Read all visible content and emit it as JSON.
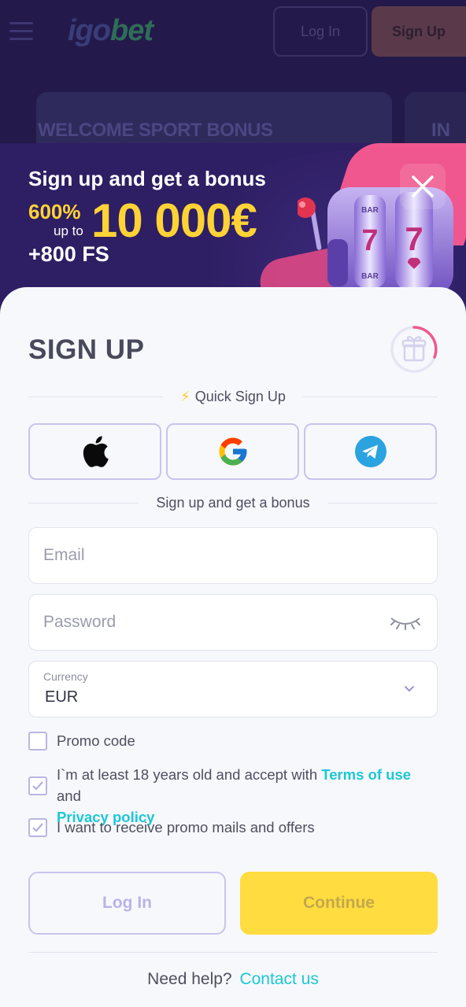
{
  "header": {
    "logo_text": "igobet",
    "login_label": "Log In",
    "signup_label": "Sign Up"
  },
  "background": {
    "banner_title": "WELCOME SPORT BONUS",
    "banner2_title": "IN"
  },
  "promo": {
    "headline": "Sign up and get a bonus",
    "percent": "600%",
    "up_to": "up to",
    "amount": "10 000€",
    "free_spins": "+800 FS"
  },
  "form": {
    "title": "SIGN UP",
    "quick_signup": "Quick Sign Up",
    "bonus_divider": "Sign up and get a bonus",
    "email_placeholder": "Email",
    "password_placeholder": "Password",
    "currency_label": "Currency",
    "currency_value": "EUR",
    "promo_code_label": "Promo code",
    "age_text_1": "I`m at least 18 years old and accept with ",
    "terms_link": "Terms of use",
    "age_text_2": " and",
    "privacy_link": "Privacy policy",
    "mails_text": "I want to receive promo mails and offers",
    "login_button": "Log In",
    "continue_button": "Continue",
    "help_text": "Need help?",
    "contact_link": "Contact us"
  },
  "checkboxes": {
    "promo_code": false,
    "age_terms": true,
    "promo_mails": true
  },
  "colors": {
    "accent_yellow": "#ffdc3f",
    "link_cyan": "#1cc7d6",
    "outline_violet": "#c9c3ee",
    "promo_bg": "#2e1e63"
  }
}
